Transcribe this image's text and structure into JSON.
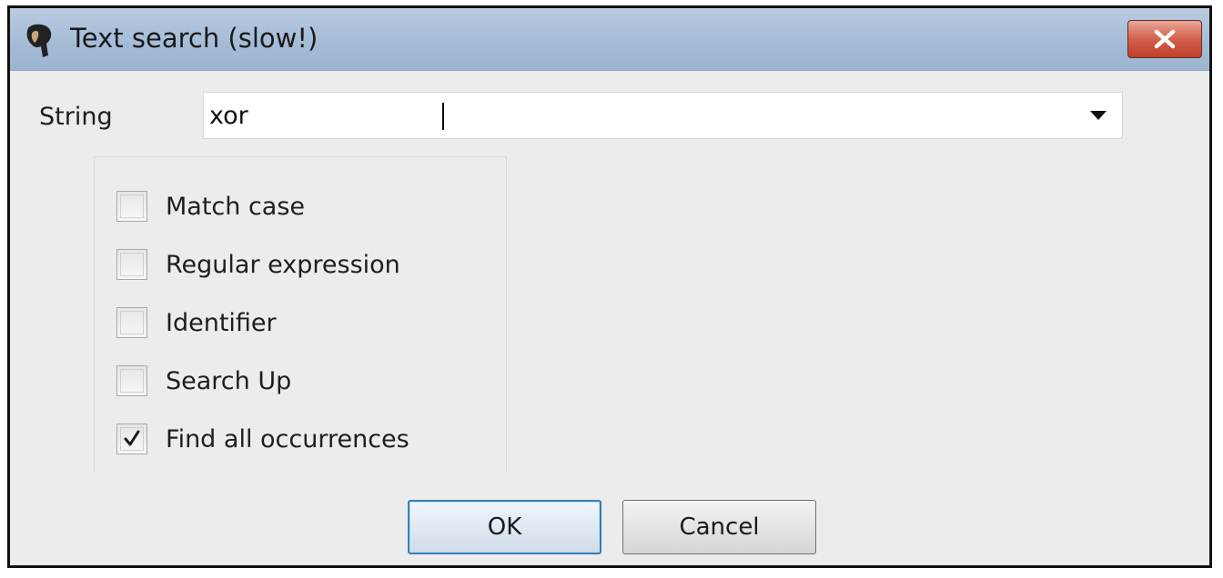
{
  "window": {
    "title": "Text search (slow!)",
    "close_label": "✕"
  },
  "form": {
    "string_label": "String",
    "string_value": "xor"
  },
  "options": [
    {
      "label": "Match case",
      "checked": false
    },
    {
      "label": "Regular expression",
      "checked": false
    },
    {
      "label": "Identifier",
      "checked": false
    },
    {
      "label": "Search Up",
      "checked": false
    },
    {
      "label": "Find all occurrences",
      "checked": true
    }
  ],
  "buttons": {
    "ok": "OK",
    "cancel": "Cancel"
  },
  "colors": {
    "titlebar": "#a4bbd6",
    "close_button": "#d2604a",
    "window_bg": "#ececec",
    "default_button_border": "#3c7fb1"
  },
  "icons": {
    "app": "app-logo-icon",
    "close": "close-icon",
    "dropdown": "dropdown-arrow-icon",
    "check": "checkmark-icon"
  }
}
